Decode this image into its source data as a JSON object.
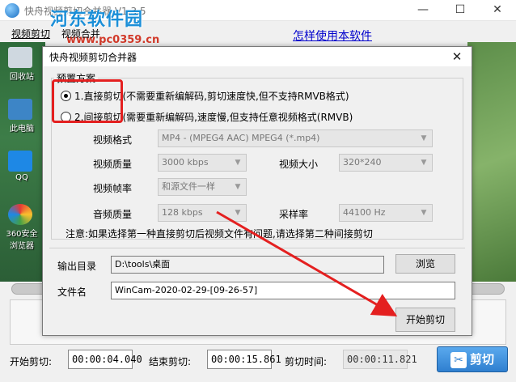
{
  "main": {
    "title": "快舟视频剪切合并器 V1.3.5",
    "watermark_text": "河东软件园",
    "watermark_url": "www.pc0359.cn",
    "tabs": [
      {
        "label": "视频剪切"
      },
      {
        "label": "视频合并"
      }
    ],
    "help_link": "怎样使用本软件",
    "min_glyph": "—",
    "max_glyph": "☐",
    "close_glyph": "✕",
    "desktop_labels": [
      "回收站",
      "此电脑",
      "QQ",
      "360安全浏览器"
    ]
  },
  "dialog": {
    "title": "快舟视频剪切合并器",
    "close_glyph": "✕",
    "preset_group_label": "预置方案",
    "option1": "1.直接剪切(不需要重新编解码,剪切速度快,但不支持RMVB格式)",
    "option2": "2.间接剪切(需要重新编解码,速度慢,但支持任意视频格式(RMVB)",
    "selected_option": 1,
    "fields": {
      "format": {
        "label": "视频格式",
        "value": "MP4 - (MPEG4 AAC) MPEG4 (*.mp4)"
      },
      "quality": {
        "label": "视频质量",
        "value": "3000 kbps"
      },
      "size": {
        "label": "视频大小",
        "value": "320*240"
      },
      "fps": {
        "label": "视频帧率",
        "value": "和源文件一样"
      },
      "audio_quality": {
        "label": "音频质量",
        "value": "128 kbps"
      },
      "sample_rate": {
        "label": "采样率",
        "value": "44100 Hz"
      }
    },
    "note": "注意:如果选择第一种直接剪切后视频文件有问题,请选择第二种间接剪切",
    "output_dir_label": "输出目录",
    "output_dir_value": "D:\\tools\\桌面",
    "browse_label": "浏览",
    "filename_label": "文件名",
    "filename_value": "WinCam-2020-02-29-[09-26-57]",
    "start_button": "开始剪切"
  },
  "bottom": {
    "start_label": "开始剪切:",
    "start_time": "00:00:04.040",
    "end_label": "结束剪切:",
    "end_time": "00:00:15.861",
    "duration_label": "剪切时间:",
    "duration_time": "00:00:11.821",
    "cut_button": "剪切"
  },
  "colors": {
    "highlight": "#e42020",
    "link": "#0000cc",
    "watermark": "#1b8fd8",
    "cut_button": "#2f7fd0"
  }
}
